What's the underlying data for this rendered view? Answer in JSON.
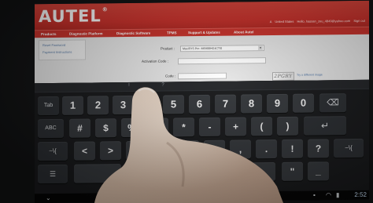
{
  "site": {
    "logo_text": "AUTEL",
    "logo_mark": "®",
    "top_links": [
      "A",
      "United States",
      "Hello, hassan_zeu_4849@yahoo.com",
      "Sign out"
    ]
  },
  "nav": {
    "items": [
      "Products",
      "Diagnostic Platform",
      "Diagnostic Software",
      "TPMS",
      "Support & Updates",
      "About Autel"
    ]
  },
  "sidebar": {
    "links": [
      "Reset Password",
      "Payment Instructions"
    ]
  },
  "form": {
    "product_label": "Product :",
    "product_value": "MaxiSYS Pro -MS908HG4CTI0",
    "activation_label": "Activation Code :",
    "activation_value": "",
    "code_label": "Code :",
    "captcha_text": "2PGRY",
    "captcha_hint": "Try a different image"
  },
  "keyboard": {
    "strip_chars": [
      "!",
      "?"
    ],
    "row1": [
      "Tab",
      "1",
      "2",
      "3",
      "4",
      "5",
      "6",
      "7",
      "8",
      "9",
      "0",
      "⌫"
    ],
    "row2": [
      "ABC",
      "#",
      "$",
      "%",
      "&",
      "*",
      "-",
      "+",
      "(",
      ")",
      "↵"
    ],
    "row3": [
      "~\\{",
      "<",
      ">",
      "",
      "",
      "",
      "",
      ";",
      ",",
      ".",
      "!",
      "?",
      "~\\{"
    ],
    "row4": [
      "",
      ":-)",
      "",
      "",
      "",
      "\"",
      "_"
    ]
  },
  "system_bar": {
    "clock": "2:52"
  },
  "colors": {
    "header_red": "#c8302a",
    "key_bg": "#34373b",
    "keyboard_bg": "#18191b"
  }
}
